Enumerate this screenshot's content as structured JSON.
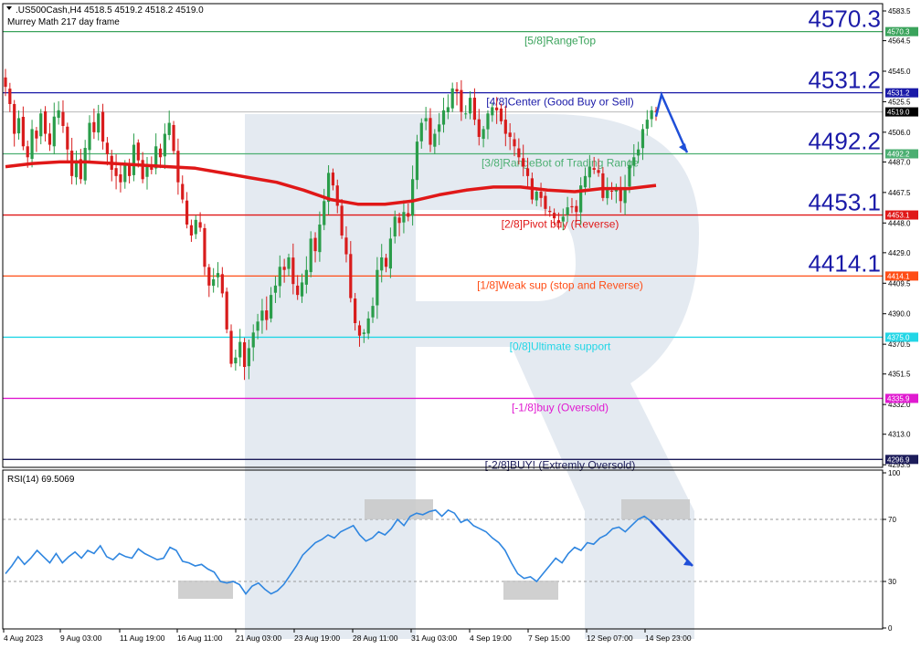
{
  "header": {
    "symbol_line": ".US500Cash,H4  4518.5 4519.2 4518.2 4519.0",
    "indicator_name": "Murrey Math 217 day frame"
  },
  "colors": {
    "up": "#2a9d4a",
    "down": "#d81c1c",
    "ma": "#e01818",
    "rsi": "#2f86e0",
    "arrow": "#1f4fd8",
    "watermark": "#dce4ef"
  },
  "chart_data": [
    {
      "type": "candlestick",
      "title": "",
      "ylim": [
        4293,
        4587
      ],
      "y_ticks": [
        "4583.5",
        "4564.5",
        "4545.0",
        "4525.5",
        "4506.0",
        "4487.0",
        "4467.5",
        "4448.0",
        "4429.0",
        "4409.5",
        "4390.0",
        "4370.5",
        "4351.5",
        "4332.0",
        "4313.0",
        "4293.5"
      ],
      "x_ticks": [
        "4 Aug 2023",
        "9 Aug 03:00",
        "11 Aug 19:00",
        "16 Aug 11:00",
        "21 Aug 03:00",
        "23 Aug 19:00",
        "28 Aug 11:00",
        "31 Aug 03:00",
        "4 Sep 19:00",
        "7 Sep 15:00",
        "12 Sep 07:00",
        "14 Sep 23:00"
      ],
      "current_price": "4519.0",
      "murrey_levels": [
        {
          "value": 4570.3,
          "price_tag": "4570.3",
          "big_label": "4570.3",
          "label": "[5/8]RangeTop",
          "color": "#3aa35b"
        },
        {
          "value": 4531.2,
          "price_tag": "4531.2",
          "big_label": "4531.2",
          "label": "[4/8]Center (Good Buy or Sell)",
          "color": "#1a1aa8"
        },
        {
          "value": 4492.2,
          "price_tag": "4492.2",
          "big_label": "4492.2",
          "label": "[3/8]RangeBot of Trading Range",
          "color": "#4caf72"
        },
        {
          "value": 4453.1,
          "price_tag": "4453.1",
          "big_label": "4453.1",
          "label": "[2/8]Pivot buy (Reverse)",
          "color": "#e01818"
        },
        {
          "value": 4414.1,
          "price_tag": "4414.1",
          "big_label": "4414.1",
          "label": "[1/8]Weak sup (stop and Reverse)",
          "color": "#ff4d16"
        },
        {
          "value": 4375.0,
          "price_tag": "4375.0",
          "big_label": "",
          "label": "[0/8]Ultimate support",
          "color": "#22d6e6"
        },
        {
          "value": 4335.9,
          "price_tag": "4335.9",
          "big_label": "",
          "label": "[-1/8]buy (Oversold)",
          "color": "#e01ad0"
        },
        {
          "value": 4296.9,
          "price_tag": "4296.9",
          "big_label": "",
          "label": "[-2/8]BUY! (Extremly Oversold)",
          "color": "#1c1c5a"
        }
      ],
      "series": [
        {
          "type": "candles",
          "note": "Close prices of H4 candles",
          "values": [
            4535,
            4524,
            4505,
            4515,
            4497,
            4490,
            4508,
            4502,
            4518,
            4505,
            4498,
            4516,
            4520,
            4510,
            4495,
            4478,
            4488,
            4476,
            4496,
            4512,
            4506,
            4518,
            4500,
            4492,
            4482,
            4478,
            4474,
            4486,
            4478,
            4498,
            4488,
            4476,
            4485,
            4482,
            4497,
            4490,
            4505,
            4512,
            4494,
            4474,
            4463,
            4447,
            4440,
            4450,
            4445,
            4420,
            4408,
            4412,
            4416,
            4403,
            4380,
            4358,
            4362,
            4372,
            4356,
            4368,
            4378,
            4385,
            4392,
            4386,
            4402,
            4408,
            4420,
            4418,
            4426,
            4409,
            4402,
            4410,
            4418,
            4438,
            4430,
            4447,
            4462,
            4480,
            4472,
            4459,
            4440,
            4428,
            4400,
            4384,
            4376,
            4378,
            4387,
            4395,
            4418,
            4426,
            4420,
            4438,
            4452,
            4448,
            4455,
            4452,
            4476,
            4500,
            4512,
            4515,
            4498,
            4505,
            4511,
            4520,
            4522,
            4534,
            4532,
            4519,
            4518,
            4528,
            4514,
            4503,
            4508,
            4518,
            4522,
            4520,
            4513,
            4505,
            4503,
            4497,
            4490,
            4484,
            4478,
            4463,
            4468,
            4464,
            4457,
            4455,
            4451,
            4448,
            4452,
            4458,
            4458,
            4455,
            4472,
            4478,
            4484,
            4482,
            4480,
            4464,
            4470,
            4468,
            4471,
            4462,
            4470,
            4485,
            4490,
            4495,
            4508,
            4514,
            4520,
            4519
          ]
        },
        {
          "type": "line",
          "name": "",
          "note": "moving average",
          "values": [
            4484,
            4486,
            4487,
            4487,
            4486,
            4485,
            4484,
            4483,
            4480,
            4477,
            4474,
            4469,
            4463,
            4460,
            4460,
            4462,
            4466,
            4469,
            4471,
            4471,
            4469,
            4468,
            4470,
            4470,
            4472
          ]
        }
      ]
    },
    {
      "type": "line",
      "title": "RSI(14) 69.5069",
      "ylim": [
        0,
        100
      ],
      "y_ticks": [
        "100",
        "70",
        "30",
        "0"
      ],
      "series": [
        {
          "name": "",
          "values": [
            35,
            40,
            46,
            41,
            45,
            50,
            46,
            42,
            48,
            42,
            46,
            49,
            45,
            50,
            48,
            53,
            46,
            44,
            48,
            46,
            45,
            51,
            48,
            46,
            44,
            45,
            52,
            50,
            43,
            42,
            40,
            41,
            38,
            36,
            30,
            29,
            30,
            28,
            22,
            27,
            29,
            25,
            22,
            24,
            28,
            34,
            40,
            47,
            51,
            55,
            57,
            60,
            58,
            62,
            64,
            66,
            60,
            56,
            58,
            62,
            60,
            64,
            70,
            66,
            72,
            74,
            73,
            75,
            76,
            72,
            76,
            74,
            68,
            70,
            66,
            64,
            62,
            58,
            55,
            50,
            42,
            35,
            32,
            33,
            30,
            35,
            40,
            45,
            42,
            48,
            52,
            50,
            55,
            54,
            58,
            60,
            64,
            65,
            62,
            66,
            70,
            72,
            69
          ]
        }
      ],
      "reference_lines": [
        70,
        30
      ]
    }
  ]
}
